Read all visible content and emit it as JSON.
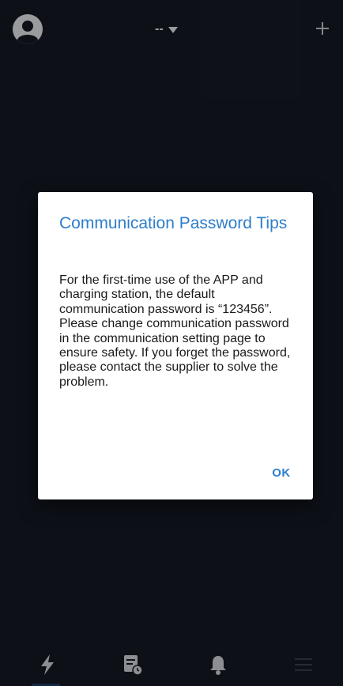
{
  "header": {
    "station_label": "--",
    "avatar_icon": "user-avatar-icon",
    "add_icon": "plus-icon"
  },
  "dialog": {
    "title": "Communication Password Tips",
    "body": "For the first-time use of the APP and charging station, the default communication password is “123456”. Please change communication password in the communication setting page to ensure safety. If you forget the password, please contact the supplier to solve the problem.",
    "ok_label": "OK"
  },
  "bottom_nav": {
    "items": [
      {
        "icon": "lightning-icon",
        "active": true
      },
      {
        "icon": "record-icon",
        "active": false
      },
      {
        "icon": "bell-icon",
        "active": false
      },
      {
        "icon": "menu-icon",
        "active": false
      }
    ]
  },
  "colors": {
    "background": "#151a24",
    "accent": "#2e7ecb",
    "nav_icon": "#d8dbe0"
  }
}
